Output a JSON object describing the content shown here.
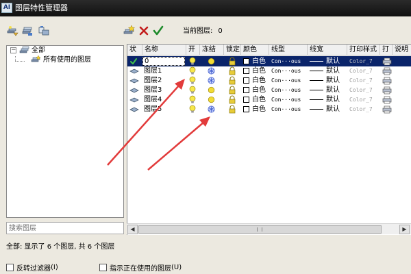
{
  "window": {
    "title": "图层特性管理器",
    "icon_text": "AI"
  },
  "toolbar": {
    "left_icons": [
      "layer-filter-new-icon",
      "layer-group-filter-icon",
      "layer-states-icon"
    ],
    "right_icons": [
      "new-layer-icon",
      "delete-layer-icon",
      "set-current-icon"
    ],
    "current_layer_label": "当前图层:",
    "current_layer_value": "0"
  },
  "tree": {
    "root": "全部",
    "children": [
      "所有使用的图层"
    ],
    "search_placeholder": "搜索图层"
  },
  "columns": [
    "状",
    "名称",
    "开",
    "冻结",
    "锁定",
    "颜色",
    "线型",
    "线宽",
    "打印样式",
    "打",
    "说明"
  ],
  "layers": [
    {
      "name": "0",
      "color": "白色",
      "linetype": "Continuous",
      "linetype_display": "Con···ous",
      "lineweight": "默认",
      "plot_style": "Color_7",
      "selected": true,
      "current": true,
      "frozen": false
    },
    {
      "name": "图层1",
      "color": "白色",
      "linetype": "Continuous",
      "linetype_display": "Con···ous",
      "lineweight": "默认",
      "plot_style": "Color_7",
      "selected": false,
      "current": false,
      "frozen": true
    },
    {
      "name": "图层2",
      "color": "白色",
      "linetype": "Continuous",
      "linetype_display": "Con···ous",
      "lineweight": "默认",
      "plot_style": "Color_7",
      "selected": false,
      "current": false,
      "frozen": true
    },
    {
      "name": "图层3",
      "color": "白色",
      "linetype": "Continuous",
      "linetype_display": "Con···ous",
      "lineweight": "默认",
      "plot_style": "Color_7",
      "selected": false,
      "current": false,
      "frozen": false
    },
    {
      "name": "图层4",
      "color": "白色",
      "linetype": "Continuous",
      "linetype_display": "Con···ous",
      "lineweight": "默认",
      "plot_style": "Color_7",
      "selected": false,
      "current": false,
      "frozen": false
    },
    {
      "name": "图层5",
      "color": "白色",
      "linetype": "Continuous",
      "linetype_display": "Con···ous",
      "lineweight": "默认",
      "plot_style": "Color_7",
      "selected": false,
      "current": false,
      "frozen": true
    }
  ],
  "status": "全部: 显示了 6 个图层, 共 6 个图层",
  "bottom": {
    "invert_filter_label": "反转过滤器",
    "invert_filter_hotkey": "(I)",
    "indicate_in_use_label": "指示正在使用的图层",
    "indicate_in_use_hotkey": "(U)"
  },
  "colors": {
    "selection": "#0a246a",
    "annotation_arrow": "#e23b3b",
    "title_bar": "#1a1a1a"
  }
}
